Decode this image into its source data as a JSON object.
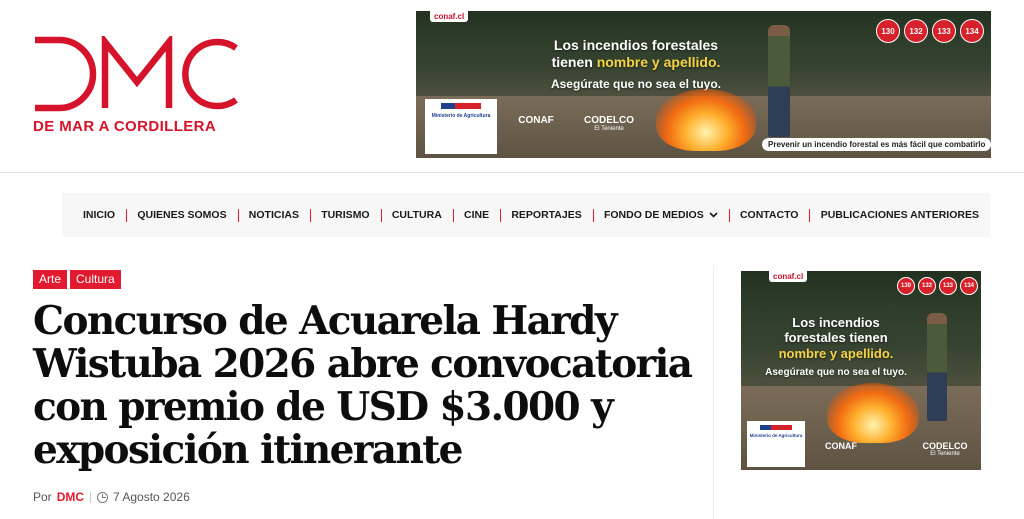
{
  "site": {
    "logo_text": "DMC",
    "tagline": "DE MAR A CORDILLERA",
    "brand_color": "#d5132b"
  },
  "top_ad": {
    "brand_tag": "conaf.cl",
    "headline_line1": "Los incendios forestales",
    "headline_line2a": "tienen ",
    "headline_line2b": "nombre y apellido.",
    "subline": "Asegúrate que no sea el tuyo.",
    "badges": [
      "130",
      "132",
      "133",
      "134"
    ],
    "ministry": "Ministerio de Agricultura",
    "partner1": "CONAF",
    "partner2": "CODELCO",
    "partner2_sub": "El Teniente",
    "tagline": "Prevenir un incendio forestal es más fácil que combatirlo"
  },
  "nav": {
    "items": [
      "INICIO",
      "QUIENES SOMOS",
      "NOTICIAS",
      "TURISMO",
      "CULTURA",
      "CINE",
      "REPORTAJES",
      "FONDO DE MEDIOS",
      "CONTACTO",
      "PUBLICACIONES ANTERIORES"
    ],
    "accent": "#e11a2f"
  },
  "article": {
    "tags": [
      "Arte",
      "Cultura"
    ],
    "title": "Concurso de Acuarela Hardy Wistuba 2026 abre convocatoria con premio de USD $3.000 y exposición itinerante",
    "by_label": "Por",
    "author": "DMC",
    "date": "7 Agosto 2026"
  },
  "side_ad": {
    "brand_tag": "conaf.cl",
    "headline_line1": "Los incendios",
    "headline_line2": "forestales tienen",
    "headline_line3": "nombre y apellido.",
    "subline": "Asegúrate que no sea el tuyo.",
    "badges": [
      "130",
      "132",
      "133",
      "134"
    ],
    "ministry": "Ministerio de Agricultura",
    "partner1": "CONAF",
    "partner2": "CODELCO",
    "partner2_sub": "El Teniente"
  }
}
